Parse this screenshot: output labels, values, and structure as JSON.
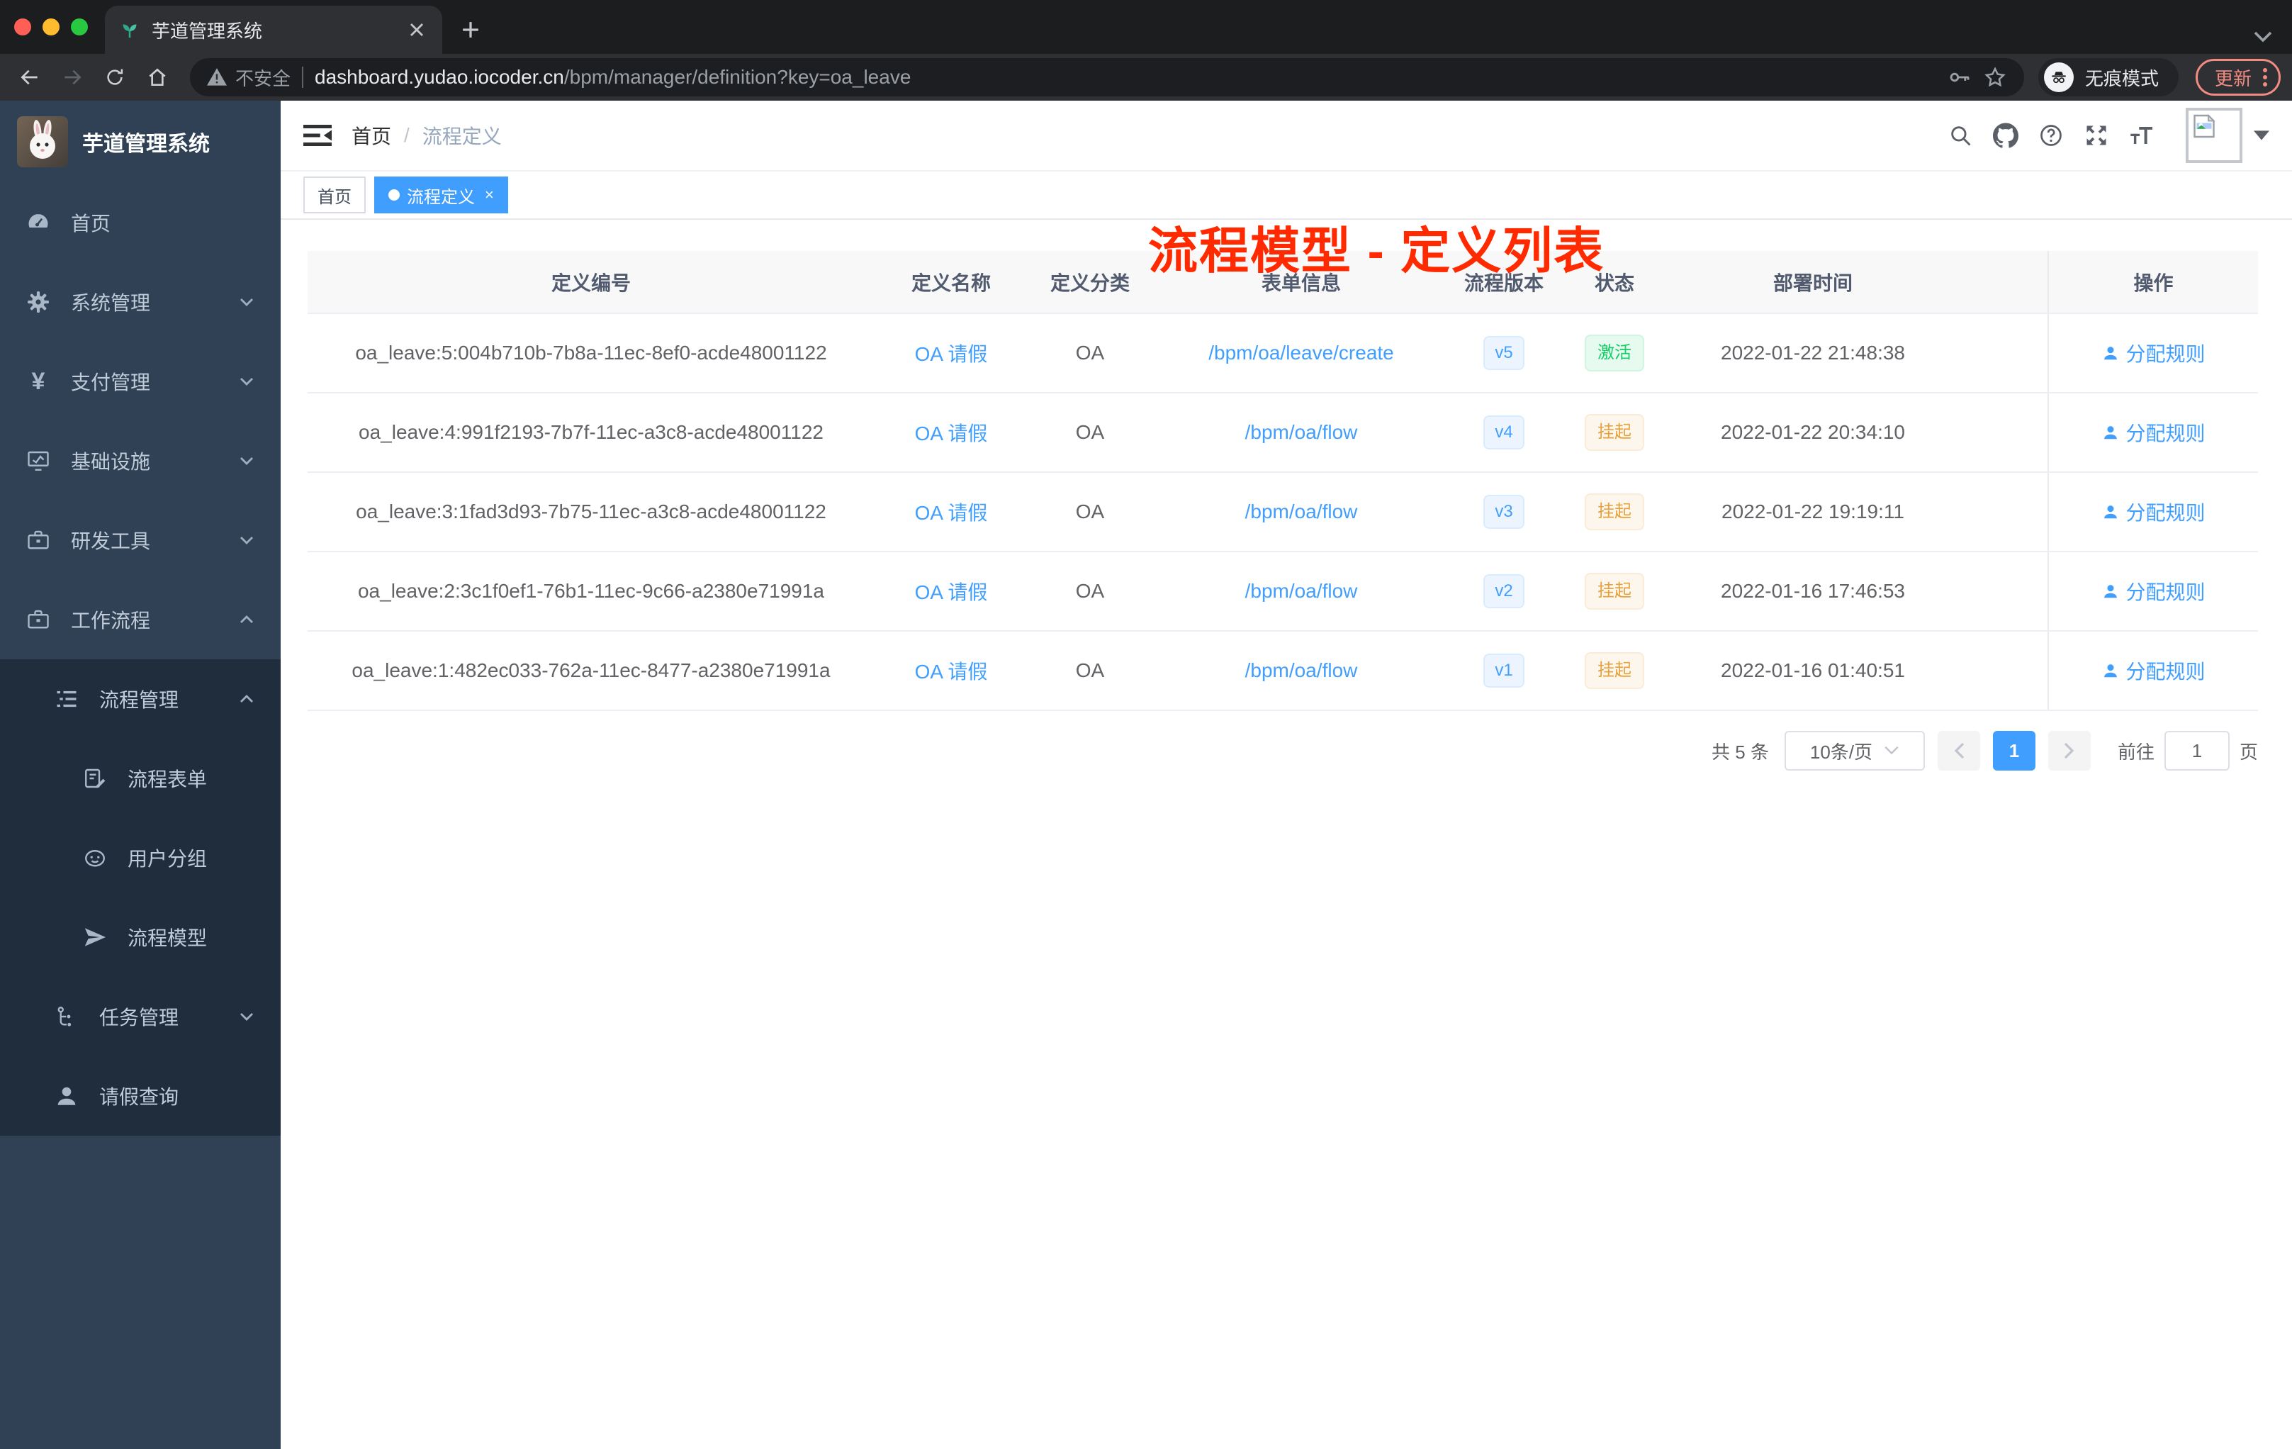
{
  "browser": {
    "tab_title": "芋道管理系统",
    "security_label": "不安全",
    "url_host": "dashboard.yudao.iocoder.cn",
    "url_path": "/bpm/manager/definition?key=oa_leave",
    "incognito_label": "无痕模式",
    "update_label": "更新"
  },
  "sidebar": {
    "app_title": "芋道管理系统",
    "items": [
      {
        "label": "首页",
        "icon": "dashboard-icon"
      },
      {
        "label": "系统管理",
        "icon": "gear-icon"
      },
      {
        "label": "支付管理",
        "icon": "yen-icon"
      },
      {
        "label": "基础设施",
        "icon": "monitor-icon"
      },
      {
        "label": "研发工具",
        "icon": "briefcase-icon"
      },
      {
        "label": "工作流程",
        "icon": "briefcase-icon"
      },
      {
        "label": "流程管理",
        "icon": "list-tree-icon"
      },
      {
        "label": "流程表单",
        "icon": "form-edit-icon"
      },
      {
        "label": "用户分组",
        "icon": "user-group-icon"
      },
      {
        "label": "流程模型",
        "icon": "paper-plane-icon"
      },
      {
        "label": "任务管理",
        "icon": "task-branch-icon"
      },
      {
        "label": "请假查询",
        "icon": "user-icon"
      }
    ]
  },
  "header": {
    "breadcrumb_home": "首页",
    "breadcrumb_sep": "/",
    "breadcrumb_current": "流程定义",
    "annotation": "流程模型 - 定义列表"
  },
  "tags": {
    "home": "首页",
    "active": "流程定义"
  },
  "table": {
    "columns": {
      "id": "定义编号",
      "name": "定义名称",
      "category": "定义分类",
      "form": "表单信息",
      "version": "流程版本",
      "status": "状态",
      "deploy_time": "部署时间",
      "actions": "操作"
    },
    "action_label": "分配规则",
    "rows": [
      {
        "id": "oa_leave:5:004b710b-7b8a-11ec-8ef0-acde48001122",
        "name": "OA 请假",
        "category": "OA",
        "form": "/bpm/oa/leave/create",
        "version": "v5",
        "status": "激活",
        "deploy_time": "2022-01-22 21:48:38"
      },
      {
        "id": "oa_leave:4:991f2193-7b7f-11ec-a3c8-acde48001122",
        "name": "OA 请假",
        "category": "OA",
        "form": "/bpm/oa/flow",
        "version": "v4",
        "status": "挂起",
        "deploy_time": "2022-01-22 20:34:10"
      },
      {
        "id": "oa_leave:3:1fad3d93-7b75-11ec-a3c8-acde48001122",
        "name": "OA 请假",
        "category": "OA",
        "form": "/bpm/oa/flow",
        "version": "v3",
        "status": "挂起",
        "deploy_time": "2022-01-22 19:19:11"
      },
      {
        "id": "oa_leave:2:3c1f0ef1-76b1-11ec-9c66-a2380e71991a",
        "name": "OA 请假",
        "category": "OA",
        "form": "/bpm/oa/flow",
        "version": "v2",
        "status": "挂起",
        "deploy_time": "2022-01-16 17:46:53"
      },
      {
        "id": "oa_leave:1:482ec033-762a-11ec-8477-a2380e71991a",
        "name": "OA 请假",
        "category": "OA",
        "form": "/bpm/oa/flow",
        "version": "v1",
        "status": "挂起",
        "deploy_time": "2022-01-16 01:40:51"
      }
    ]
  },
  "pagination": {
    "total": "共 5 条",
    "page_size": "10条/页",
    "page": "1",
    "goto": "前往",
    "goto_value": "1",
    "page_unit": "页"
  },
  "colors": {
    "accent_blue": "#409eff",
    "annotation_red": "#ff2a00",
    "status_active_green": "#13ce66",
    "status_suspended_orange": "#e6a23c",
    "sidebar_bg": "#304156",
    "submenu_bg": "#1f2d3d"
  },
  "icons": {
    "favicon": "seedling",
    "browser": [
      "back",
      "forward",
      "reload",
      "home",
      "warning",
      "key",
      "star",
      "incognito",
      "more-vertical"
    ],
    "navbar": [
      "search",
      "github",
      "help-circle",
      "fullscreen",
      "font-size",
      "caret-down"
    ]
  }
}
